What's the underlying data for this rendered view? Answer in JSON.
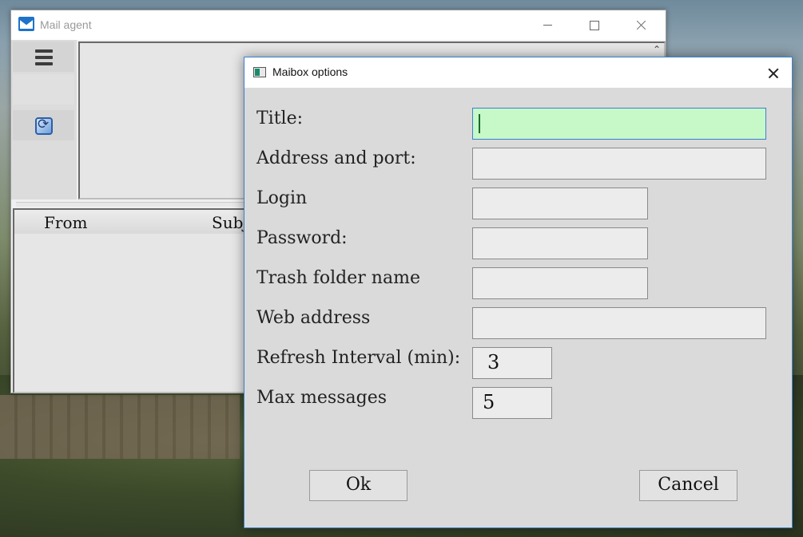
{
  "main_window": {
    "title": "Mail agent",
    "columns": [
      "From",
      "Subj"
    ]
  },
  "dialog": {
    "title": "Maibox options",
    "fields": [
      {
        "label": "Title:",
        "value": ""
      },
      {
        "label": "Address and port:",
        "value": ""
      },
      {
        "label": "Login",
        "value": ""
      },
      {
        "label": "Password:",
        "value": ""
      },
      {
        "label": "Trash folder name",
        "value": ""
      },
      {
        "label": "Web address",
        "value": ""
      },
      {
        "label": "Refresh Interval (min):",
        "value": "3"
      },
      {
        "label": "Max messages",
        "value": "5"
      }
    ],
    "ok_label": "Ok",
    "cancel_label": "Cancel"
  },
  "icons": [
    "mail-app-icon",
    "menu-icon",
    "refresh-icon",
    "dialog-app-icon",
    "close-icon",
    "minimize-icon",
    "maximize-icon",
    "scroll-up-icon"
  ],
  "colors": {
    "active_field": "#c6f8c8",
    "dialog_border": "#3b82d1"
  }
}
